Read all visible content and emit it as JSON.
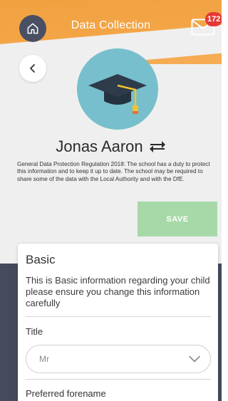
{
  "header": {
    "title": "Data Collection",
    "notification_count": "172",
    "accent_color": "#f0a13f",
    "icons": [
      "home-icon",
      "mail-icon"
    ]
  },
  "profile": {
    "name": "Jonas Aaron",
    "avatar_icon": "graduation-cap-icon",
    "switch_icon": "switch-arrows-icon"
  },
  "notice": {
    "text": "General Data Protection Regulation 2018: The school has a duty to protect this information and to keep it up to date. The school may be required to share some of the data with the Local Authority and with the DfE."
  },
  "actions": {
    "save_label": "SAVE",
    "save_color": "#a7d9a8"
  },
  "basic_section": {
    "title": "Basic",
    "description": "This is Basic information regarding your child please ensure you change this information carefully",
    "fields": {
      "title_label": "Title",
      "title_value": "Mr",
      "preferred_forename_label": "Preferred forename"
    }
  }
}
